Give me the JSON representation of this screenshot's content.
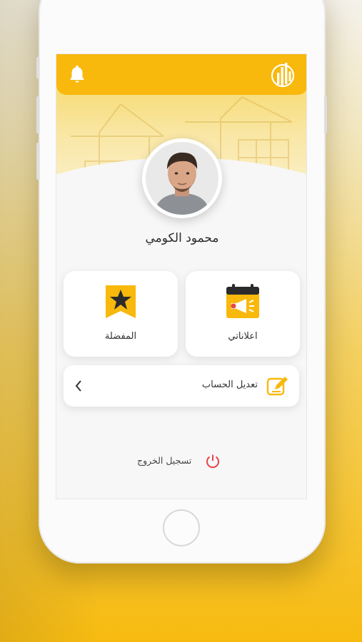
{
  "profile": {
    "name": "محمود الكومي"
  },
  "cards": [
    {
      "label": "اعلاناتي",
      "icon": "calendar-megaphone-icon"
    },
    {
      "label": "المفضلة",
      "icon": "bookmark-star-icon"
    }
  ],
  "menu": {
    "edit_account": "تعديل الحساب",
    "edit_icon": "edit-pencil-icon",
    "chevron_icon": "chevron-left-icon"
  },
  "logout": {
    "label": "تسجيل الخروج",
    "icon": "power-icon"
  },
  "header": {
    "left_icon": "bell-icon",
    "right_icon": "app-logo-icon"
  },
  "colors": {
    "accent": "#F8B80C",
    "danger": "#E8454B",
    "card_bg": "#FFFFFF"
  }
}
